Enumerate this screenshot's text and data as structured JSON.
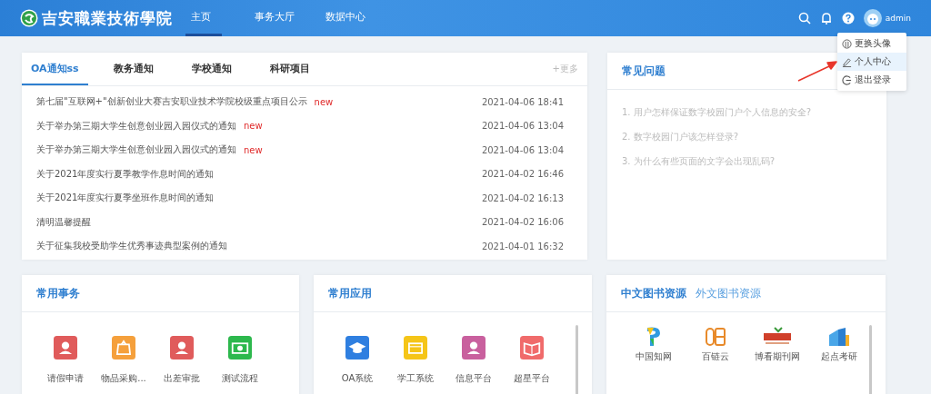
{
  "header": {
    "logo_text": "吉安職業技術學院",
    "nav": [
      {
        "label": "主页",
        "selected": true
      },
      {
        "label": "事务大厅",
        "selected": false
      },
      {
        "label": "数据中心",
        "selected": false
      }
    ],
    "username": "admin"
  },
  "user_menu": [
    {
      "label": "更换头像",
      "kind": "avatar",
      "selected": false
    },
    {
      "label": "个人中心",
      "kind": "pen",
      "selected": true
    },
    {
      "label": "退出登录",
      "kind": "logout",
      "selected": false
    }
  ],
  "notices": {
    "tabs": [
      {
        "label": "OA通知ss",
        "selected": true
      },
      {
        "label": "教务通知",
        "selected": false
      },
      {
        "label": "学校通知",
        "selected": false
      },
      {
        "label": "科研项目",
        "selected": false
      }
    ],
    "more": "+更多",
    "rows": [
      {
        "title": "第七届\"互联网+\"创新创业大赛吉安职业技术学院校级重点项目公示",
        "new": "new",
        "date": "2021-04-06 18:41"
      },
      {
        "title": "关于举办第三期大学生创意创业园入园仪式的通知",
        "new": "new",
        "date": "2021-04-06 13:04"
      },
      {
        "title": "关于举办第三期大学生创意创业园入园仪式的通知",
        "new": "new",
        "date": "2021-04-06 13:04"
      },
      {
        "title": "关于2021年度实行夏季教学作息时间的通知",
        "date": "2021-04-02 16:46"
      },
      {
        "title": "关于2021年度实行夏季坐班作息时间的通知",
        "date": "2021-04-02 16:13"
      },
      {
        "title": "清明温馨提醒",
        "date": "2021-04-02 16:06"
      },
      {
        "title": "关于征集我校受助学生优秀事迹典型案例的通知",
        "date": "2021-04-01 16:32"
      }
    ]
  },
  "faq": {
    "title": "常见问题",
    "items": [
      "1. 用户怎样保证数字校园门户个人信息的安全?",
      "2. 数字校园门户该怎样登录?",
      "3. 为什么有些页面的文字会出现乱码?"
    ]
  },
  "affairs": {
    "title": "常用事务",
    "items": [
      {
        "label": "请假申请",
        "color": "#e05b5b",
        "kind": "person"
      },
      {
        "label": "物品采购...",
        "color": "#f5a03c",
        "kind": "bag"
      },
      {
        "label": "出差审批",
        "color": "#e05b5b",
        "kind": "person"
      },
      {
        "label": "测试流程",
        "color": "#2db84d",
        "kind": "money"
      }
    ]
  },
  "apps": {
    "title": "常用应用",
    "items": [
      {
        "label": "OA系统",
        "color": "#2f7fe0",
        "kind": "cap"
      },
      {
        "label": "学工系统",
        "color": "#f5c518",
        "kind": "card"
      },
      {
        "label": "信息平台",
        "color": "#c9609e",
        "kind": "person"
      },
      {
        "label": "超星平台",
        "color": "#f06b6b",
        "kind": "book"
      }
    ]
  },
  "library": {
    "tabs": [
      {
        "label": "中文图书资源",
        "selected": true
      },
      {
        "label": "外文图书资源",
        "selected": false
      }
    ],
    "items": [
      {
        "label": "中国知网",
        "kind": "question"
      },
      {
        "label": "百链云",
        "kind": "chain"
      },
      {
        "label": "博看期刊网",
        "kind": "banner"
      },
      {
        "label": "起点考研",
        "kind": "books"
      }
    ]
  }
}
